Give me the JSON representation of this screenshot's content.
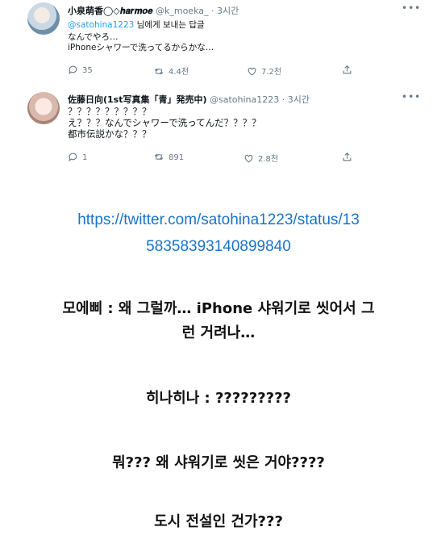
{
  "tweets": [
    {
      "display_name": "小泉萌香◯◇𝒉𝒂𝒓𝒎𝒐𝒆",
      "handle": "@k_moeka_",
      "time": "· 3시간",
      "reply_mention": "@satohina1223",
      "reply_suffix": " 님에게 보내는 답글",
      "text": "なんでやろ…\niPhoneシャワーで洗ってるからかな…",
      "reply_count": "35",
      "retweet_count": "4.4천",
      "like_count": "7.2천"
    },
    {
      "display_name": "佐藤日向(1st写真集「青」発売中)",
      "handle": "@satohina1223",
      "time": "· 3시간",
      "text": "？？？？？？？？？\nえ？？？なんでシャワーで洗ってんだ？？？？\n都市伝説かな？？？",
      "reply_count": "1",
      "retweet_count": "891",
      "like_count": "2.8천"
    }
  ],
  "link": {
    "line1": "https://twitter.com/satohina1223/status/13",
    "line2": "58358393140899840"
  },
  "captions": {
    "moeka_line1": "모에삐 : 왜 그럴까… iPhone 샤워기로 씻어서 그",
    "moeka_line2": "런 거려나…",
    "hina": "히나히나 : ?????????",
    "question": "뭐??? 왜 샤워기로 씻은 거야????",
    "legend": "도시 전설인 건가???"
  },
  "icons": {
    "more": "more-horizontal-icon",
    "reply": "reply-icon",
    "retweet": "retweet-icon",
    "like": "heart-icon",
    "share": "share-icon"
  },
  "colors": {
    "link": "#1a73c8",
    "mention": "#1da1f2",
    "muted": "#657786"
  }
}
